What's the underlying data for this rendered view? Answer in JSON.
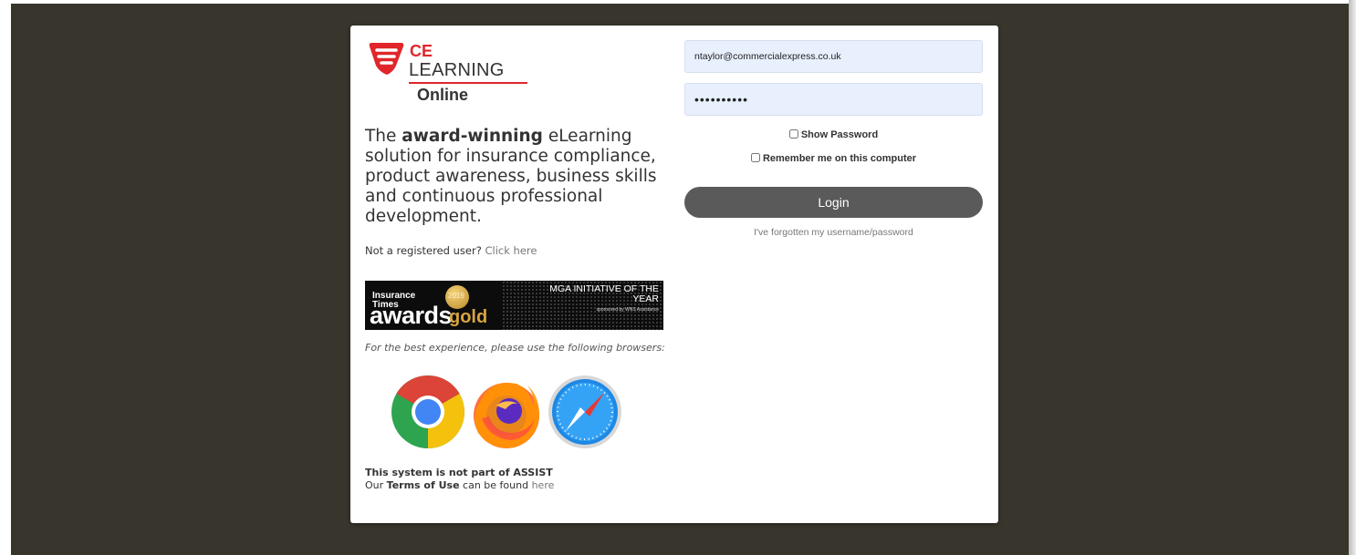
{
  "logo": {
    "ce": "CE",
    "learning": "LEARNING",
    "online": "Online"
  },
  "tagline": {
    "prefix": "The ",
    "bold": "award-winning",
    "suffix": " eLearning solution for insurance compliance, product awareness, business skills and continuous professional development."
  },
  "register": {
    "text": "Not a registered user? ",
    "link": "Click here"
  },
  "award_banner": {
    "publication": "Insurance Times",
    "awards": "awards",
    "gold": "gold",
    "year": "2019",
    "title": "MGA INITIATIVE OF THE YEAR",
    "sponsor": "sponsored by WNS Assistance"
  },
  "browsers_note": "For the best experience, please use the following browsers:",
  "browsers": [
    "chrome-icon",
    "firefox-icon",
    "safari-icon"
  ],
  "notice": {
    "line1": "This system is not part of ASSIST",
    "line2_prefix": "Our ",
    "line2_bold": "Terms of Use",
    "line2_middle": " can be found ",
    "line2_link": "here"
  },
  "login_form": {
    "email_value": "ntaylor@commercialexpress.co.uk",
    "password_value": "••••••••••",
    "show_password_label": "Show Password",
    "remember_label": "Remember me on this computer",
    "login_label": "Login",
    "forgot_label": "I've forgotten my username/password"
  },
  "colors": {
    "background": "#38352c",
    "brand_red": "#e0262b",
    "button": "#5a5a5a",
    "input_bg": "#e8f0fe"
  }
}
